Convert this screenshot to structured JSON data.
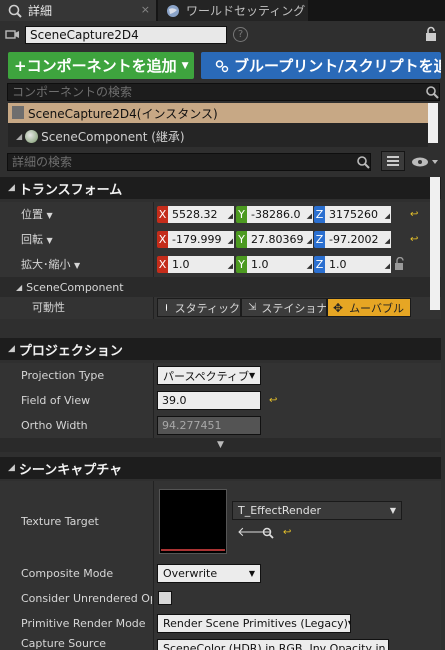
{
  "tabs": [
    {
      "label": "詳細",
      "active": true,
      "close": "×"
    },
    {
      "label": "ワールドセッティング",
      "active": false
    }
  ],
  "header": {
    "name_value": "SceneCapture2D4",
    "help": "?",
    "add_component": "+コンポーネントを追加",
    "blueprint_button": "ブループリント/スクリプトを追加",
    "component_search_placeholder": "コンポーネントの検索"
  },
  "components": {
    "selected": "SceneCapture2D4(インスタンス)",
    "child": "SceneComponent (継承)"
  },
  "details_search_placeholder": "詳細の検索",
  "transform": {
    "title": "トランスフォーム",
    "rows": [
      {
        "label": "位置",
        "x": "5528.32",
        "y": "-38286.0",
        "z": "3175260"
      },
      {
        "label": "回転",
        "x": "-179.999",
        "y": "27.80369",
        "z": "-97.2002"
      },
      {
        "label": "拡大･縮小",
        "x": "1.0",
        "y": "1.0",
        "z": "1.0"
      }
    ],
    "axis_labels": {
      "x": "X",
      "y": "Y",
      "z": "Z"
    }
  },
  "scene_component": {
    "title": "SceneComponent",
    "mobility_label": "可動性",
    "options": [
      "スタティック",
      "ステイショナリ",
      "ムーバブル"
    ],
    "selected": "ムーバブル"
  },
  "projection": {
    "title": "プロジェクション",
    "projection_type_label": "Projection Type",
    "projection_type_value": "パースペクティブ",
    "fov_label": "Field of View",
    "fov_value": "39.0",
    "ortho_label": "Ortho Width",
    "ortho_value": "94.277451"
  },
  "scene_capture": {
    "title": "シーンキャプチャ",
    "texture_target_label": "Texture Target",
    "texture_asset": "T_EffectRender",
    "composite_label": "Composite Mode",
    "composite_value": "Overwrite",
    "unrendered_label": "Consider Unrendered Opacity",
    "primitive_label": "Primitive Render Mode",
    "primitive_value": "Render Scene Primitives (Legacy)",
    "capture_source_label": "Capture Source",
    "capture_source_value": "SceneColor (HDR) in RGB, Inv Opacity in A"
  },
  "colors": {
    "panel": "#2f2f2f",
    "header": "#1d1d1d",
    "green_button": "#3ea43e",
    "blue_button": "#2a6ab8",
    "selection": "#c7a885",
    "axis_x": "#c42c1a",
    "axis_y": "#4c9a20",
    "axis_z": "#2a6fd0",
    "movable": "#e6a624"
  }
}
